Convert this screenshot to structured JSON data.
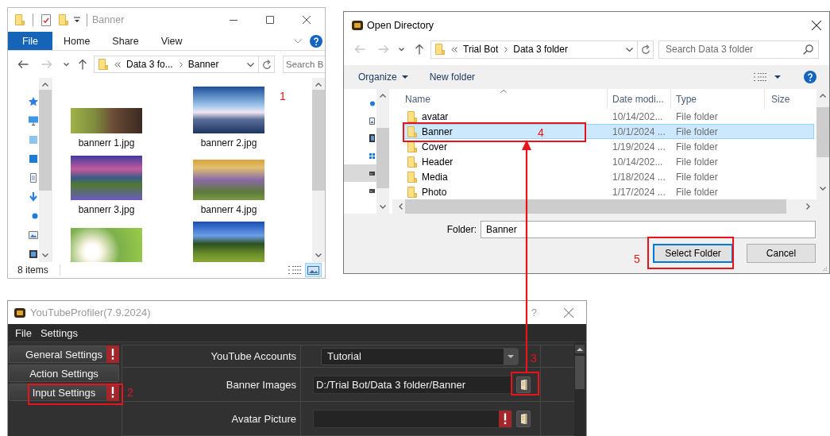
{
  "explorer": {
    "title": "Banner",
    "ribbon_tabs": [
      {
        "label": "File",
        "kind": "file"
      },
      {
        "label": "Home",
        "kind": "tab"
      },
      {
        "label": "Share",
        "kind": "tab"
      },
      {
        "label": "View",
        "kind": "tab"
      }
    ],
    "nav_buttons": [
      {
        "kind": "back",
        "disabled": false
      },
      {
        "kind": "forward",
        "disabled": true
      },
      {
        "kind": "recent",
        "disabled": false
      },
      {
        "kind": "up",
        "disabled": false
      }
    ],
    "address": {
      "crumbs": [
        "Data 3 fo...",
        "Banner"
      ]
    },
    "search": {
      "placeholder": "Search B"
    },
    "files": [
      {
        "kind": "labeled",
        "name": "bannerr 1.jpg"
      },
      {
        "kind": "labeled",
        "name": "bannerr 2.jpg"
      },
      {
        "kind": "labeled",
        "name": "bannerr 3.jpg"
      },
      {
        "kind": "labeled",
        "name": "bannerr 4.jpg"
      },
      {
        "kind": "cut"
      },
      {
        "kind": "cut"
      }
    ],
    "status_bar": {
      "item_count": "8 items"
    },
    "view_buttons": [
      {
        "kind": "details",
        "selected": false
      },
      {
        "kind": "large_icons",
        "selected": true
      }
    ]
  },
  "open_directory": {
    "title": "Open Directory",
    "nav_buttons": [
      {
        "kind": "back",
        "disabled": true
      },
      {
        "kind": "forward",
        "disabled": true
      },
      {
        "kind": "recent",
        "disabled": false
      },
      {
        "kind": "up",
        "disabled": false
      }
    ],
    "address": {
      "crumbs": [
        "Trial Bot",
        "Data 3 folder"
      ]
    },
    "search": {
      "placeholder": "Search Data 3 folder"
    },
    "toolbar": {
      "organize": "Organize",
      "new_folder": "New folder"
    },
    "nav_pane": [
      {
        "kind": "dot",
        "selected": false
      },
      {
        "kind": "picture",
        "selected": false
      },
      {
        "kind": "film",
        "selected": false
      },
      {
        "kind": "grid",
        "selected": false
      },
      {
        "kind": "drive",
        "selected": true
      },
      {
        "kind": "drive",
        "selected": false
      }
    ],
    "columns": [
      "Name",
      "Date modi...",
      "Type",
      "Size"
    ],
    "rows": [
      {
        "name": "avatar",
        "date": "10/14/202...",
        "type": "File folder",
        "selected": false
      },
      {
        "name": "Banner",
        "date": "10/1/2024 ...",
        "type": "File folder",
        "selected": true
      },
      {
        "name": "Cover",
        "date": "1/19/2024 ...",
        "type": "File folder",
        "selected": false
      },
      {
        "name": "Header",
        "date": "10/14/202...",
        "type": "File folder",
        "selected": false
      },
      {
        "name": "Media",
        "date": "1/18/2024 ...",
        "type": "File folder",
        "selected": false
      },
      {
        "name": "Photo",
        "date": "1/17/2024 ...",
        "type": "File folder",
        "selected": false
      }
    ],
    "folder_field": {
      "label": "Folder:",
      "value": "Banner"
    },
    "buttons": [
      {
        "label": "Select Folder",
        "kind": "default"
      },
      {
        "label": "Cancel",
        "kind": "normal"
      }
    ]
  },
  "youtube_profiler": {
    "title": "YouTubeProfiler(7.9.2024)",
    "help": "?",
    "menu": [
      "File",
      "Settings"
    ],
    "nav": [
      {
        "label": "General Settings",
        "warning": true
      },
      {
        "label": "Action Settings",
        "warning": false
      },
      {
        "label": "Input Settings",
        "warning": true
      }
    ],
    "fields": [
      {
        "label": "YouTube Accounts",
        "kind": "dropdown",
        "value": "Tutorial",
        "warning": false
      },
      {
        "label": "Banner Images",
        "kind": "path",
        "value": "D:/Trial Bot/Data 3 folder/Banner",
        "warning": false
      },
      {
        "label": "Avatar Picture",
        "kind": "path",
        "warning": true
      }
    ]
  },
  "annotations": [
    {
      "label": "1",
      "kind": "number"
    },
    {
      "label": "2",
      "kind": "boxed"
    },
    {
      "label": "3",
      "kind": "boxed"
    },
    {
      "label": "4",
      "kind": "boxed"
    },
    {
      "label": "5",
      "kind": "boxed"
    }
  ]
}
